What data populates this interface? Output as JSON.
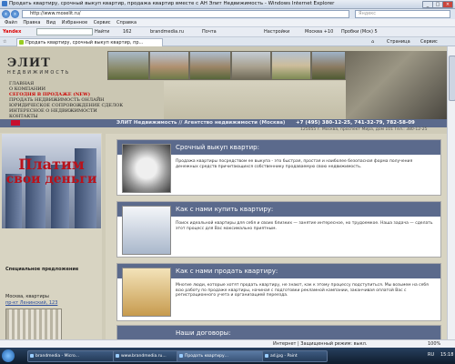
{
  "window": {
    "title": "Продать квартиру, срочный выкуп квартир, продажа квартир вместе с АН Элит Недвижимость - Windows Internet Explorer",
    "minimize": "_",
    "maximize": "□",
    "close": "×"
  },
  "addressbar": {
    "url": "http://www.moselit.ru/",
    "search_placeholder": "Яндекс"
  },
  "menu": [
    "Файл",
    "Правка",
    "Вид",
    "Избранное",
    "Сервис",
    "Справка"
  ],
  "toolbar": {
    "brand": "Yandex",
    "find": "Найти",
    "count": "162",
    "site": "brandmedia.ru",
    "mail": "Почта",
    "settings": "Настройки",
    "weather": "Москва +10",
    "traffic": "Пробки (Мск) 5"
  },
  "tabbar": {
    "tab_title": "Продать квартиру, срочный выкуп квартир, пр...",
    "page_menu": "Страница",
    "tools_menu": "Сервис"
  },
  "site": {
    "logo": "ЭЛИТ",
    "logo_sub": "НЕДВИЖИМОСТЬ",
    "nav": [
      "ГЛАВНАЯ",
      "О КОМПАНИИ",
      "СЕГОДНЯ В ПРОДАЖЕ (NEW)",
      "ПРОДАТЬ НЕДВИЖИМОСТЬ ОНЛАЙН",
      "ЮРИДИЧЕСКОЕ СОПРОВОЖДЕНИЕ СДЕЛОК",
      "ИНТЕРЕСНОЕ О НЕДВИЖИМОСТИ",
      "КОНТАКТЫ"
    ],
    "nav_active_index": 2,
    "brand_line": "ЭЛИТ Недвижимость // Агентство недвижимости (Москва)",
    "phone": "+7 (495) 380-12-25, 741-32-79, 782-58-09",
    "address": "125055 г. Москва, проспект Мира, дом 101 Тел.: 380-12-25"
  },
  "sidebar": {
    "banner_line1": "Платим",
    "banner_line2": "свои деньги",
    "special_title": "Специальное предложение",
    "offer_city": "Москва, квартиры",
    "offer_street": "пр-кт Ленинский, 123"
  },
  "cards": [
    {
      "title": "Срочный выкуп квартир:",
      "text": "Продажа квартиры посредством ее выкупа - это быстрая, простая и наиболее безопасная форма получения денежных средств причитающихся собственнику продаваемую свою недвижимость."
    },
    {
      "title": "Как с нами купить квартиру:",
      "text": "Поиск идеальной квартиры для себя и своих близких — занятие интересное, но трудоемкое. Наша задача — сделать этот процесс для Вас максимально приятным."
    },
    {
      "title": "Как с нами продать квартиру:",
      "text": "Многие люди, которые хотят продать квартиру, не знают, как к этому процессу подступиться. Мы возьмем на себя всю работу по продаже квартиры, начиная с подготовки рекламной кампании, заканчивая оплатой Вас с регистрационного учета и организацией переезда."
    },
    {
      "title": "Наши договоры:",
      "text": ""
    }
  ],
  "statusbar": {
    "zone": "Интернет | Защищенный режим: выкл.",
    "zoom": "100%"
  },
  "taskbar": {
    "items": [
      "brandmedia - Micro...",
      "www.brandmedia.ru...",
      "Продать квартиру...",
      "ad.jpg - Paint"
    ],
    "lang": "RU",
    "time": "15:18"
  }
}
